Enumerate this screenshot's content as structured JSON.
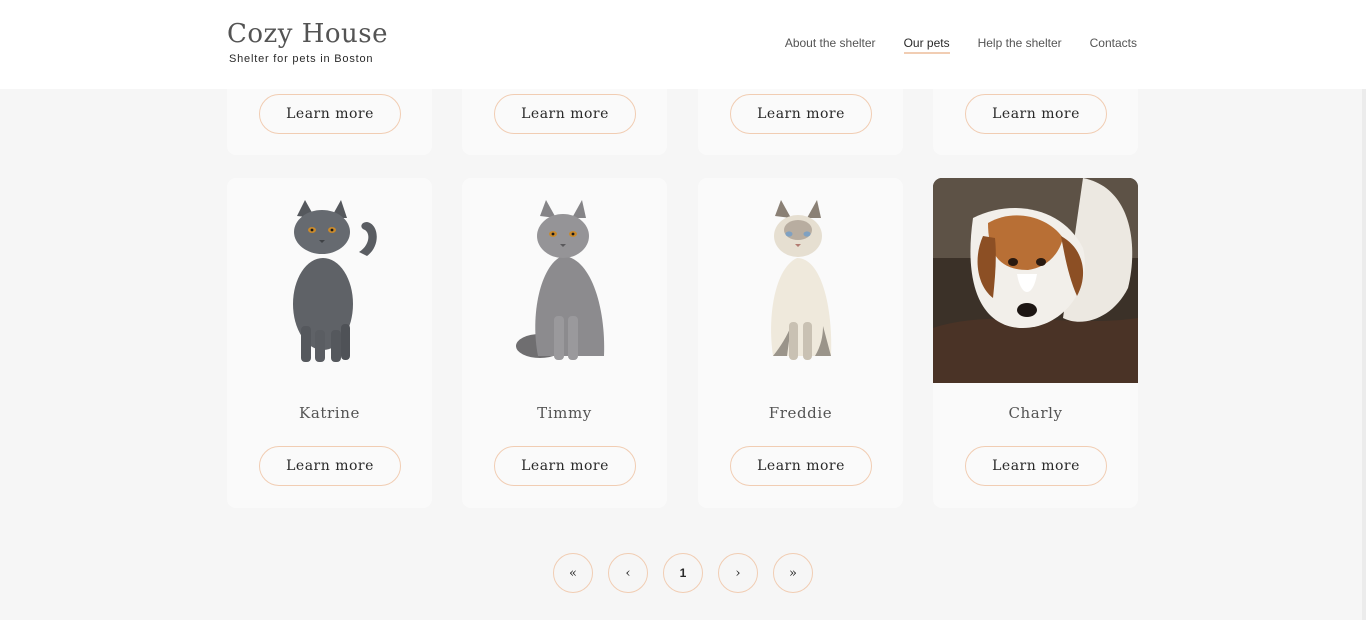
{
  "header": {
    "logo_title": "Cozy House",
    "logo_subtitle": "Shelter for pets in Boston",
    "nav": [
      {
        "label": "About the shelter",
        "active": false
      },
      {
        "label": "Our pets",
        "active": true
      },
      {
        "label": "Help the shelter",
        "active": false
      },
      {
        "label": "Contacts",
        "active": false
      }
    ]
  },
  "top_row": {
    "buttons": [
      "Learn more",
      "Learn more",
      "Learn more",
      "Learn more"
    ]
  },
  "pets": [
    {
      "name": "Katrine",
      "button": "Learn more",
      "image": "gray-cat-standing"
    },
    {
      "name": "Timmy",
      "button": "Learn more",
      "image": "gray-cat-sitting"
    },
    {
      "name": "Freddie",
      "button": "Learn more",
      "image": "siamese-cat-sitting"
    },
    {
      "name": "Charly",
      "button": "Learn more",
      "image": "dog-lying-photo"
    }
  ],
  "pagination": {
    "first": "«",
    "prev": "‹",
    "current": "1",
    "next": "›",
    "last": "»"
  },
  "colors": {
    "accent": "#f1cdb3",
    "background": "#f6f6f6",
    "card": "#fafafa",
    "text": "#545454"
  }
}
